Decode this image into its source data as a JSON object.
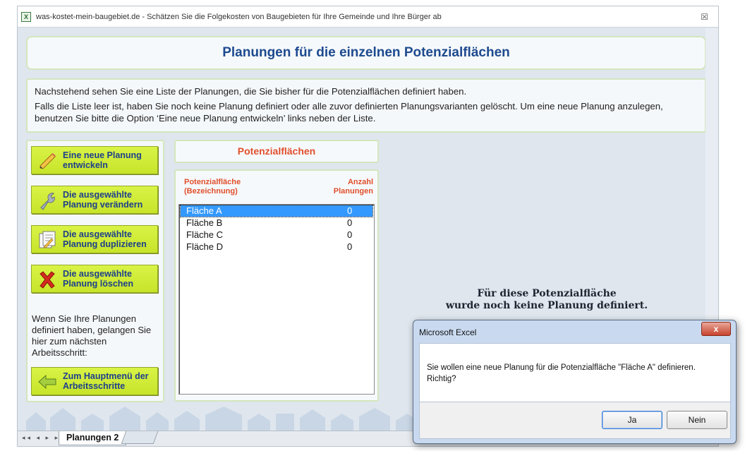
{
  "window": {
    "title": "was-kostet-mein-baugebiet.de - Schätzen Sie die Folgekosten von Baugebieten für Ihre Gemeinde und Ihre Bürger ab",
    "close_glyph": "☒"
  },
  "header": {
    "title": "Planungen für die einzelnen Potenzialflächen"
  },
  "info": {
    "line1": "Nachstehend sehen Sie eine Liste der Planungen, die Sie bisher für die Potenzialflächen definiert haben.",
    "line2": "Falls die Liste leer ist, haben Sie noch keine Planung definiert oder alle zuvor definierten Planungsvarianten gelöscht. Um eine neue Planung anzulegen, benutzen Sie bitte die Option ‘Eine neue Planung entwickeln’ links neben der Liste."
  },
  "actions": [
    {
      "label": "Eine neue Planung entwickeln",
      "icon": "pencil-icon"
    },
    {
      "label": "Die ausgewählte Planung verändern",
      "icon": "wrench-icon"
    },
    {
      "label": "Die ausgewählte Planung duplizieren",
      "icon": "copy-document-icon"
    },
    {
      "label": "Die ausgewählte Planung löschen",
      "icon": "red-x-icon"
    }
  ],
  "helper_text": "Wenn Sie Ihre Planungen definiert haben, gelangen Sie hier zum nächsten Arbeitsschritt:",
  "main_menu_button": {
    "label": "Zum Hauptmenü der Arbeitsschritte",
    "icon": "back-arrow-icon"
  },
  "potential_areas": {
    "title": "Potenzialflächen",
    "col_name": "Potenzialfläche (Bezeichnung)",
    "col_count": "Anzahl Planungen",
    "rows": [
      {
        "name": "Fläche A",
        "count": "0",
        "selected": true
      },
      {
        "name": "Fläche B",
        "count": "0",
        "selected": false
      },
      {
        "name": "Fläche C",
        "count": "0",
        "selected": false
      },
      {
        "name": "Fläche D",
        "count": "0",
        "selected": false
      }
    ]
  },
  "no_plan_message": {
    "line1": "Für diese Potenzialfläche",
    "line2": "wurde noch keine Planung definiert."
  },
  "sheet_tabs": {
    "nav": "◂◂ ◂ ▸ ▸▸",
    "active": "Planungen 2"
  },
  "dialog": {
    "title": "Microsoft Excel",
    "close": "x",
    "message_line1": "Sie wollen eine neue Planung für die Potenzialfläche \"Fläche A\" definieren.",
    "message_line2": "Richtig?",
    "yes": "Ja",
    "no": "Nein"
  },
  "colors": {
    "accent_title": "#1d4a8f",
    "accent_orange": "#e04f2c",
    "button_green": "#c7e42a",
    "selection_blue": "#3399ff"
  }
}
